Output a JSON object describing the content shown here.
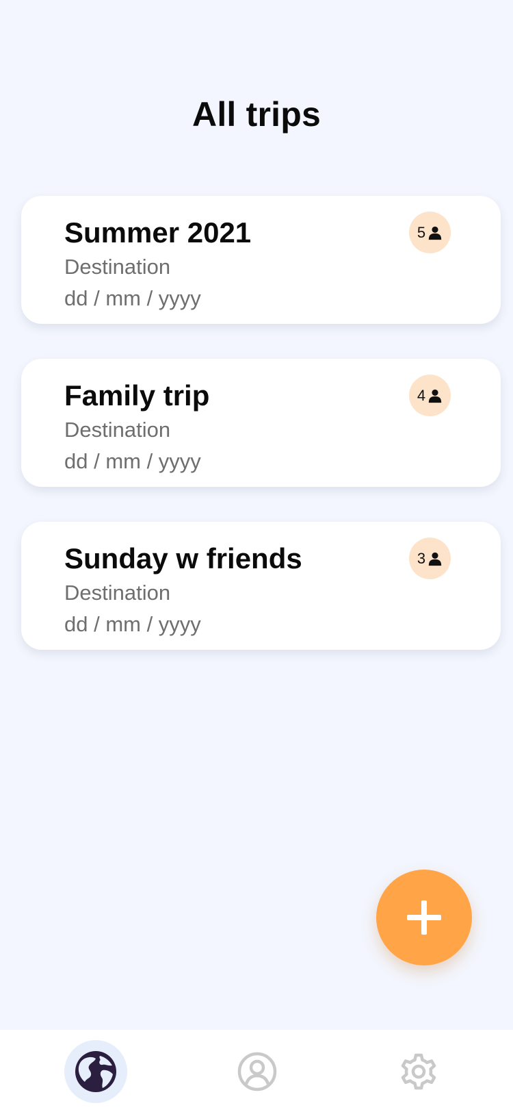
{
  "header": {
    "title": "All trips"
  },
  "trips": [
    {
      "name": "Summer 2021",
      "destination": "Destination",
      "date": "dd / mm / yyyy",
      "members": "5"
    },
    {
      "name": "Family trip",
      "destination": "Destination",
      "date": "dd / mm / yyyy",
      "members": "4"
    },
    {
      "name": "Sunday w friends",
      "destination": "Destination",
      "date": "dd / mm / yyyy",
      "members": "3"
    }
  ],
  "fab": {
    "icon": "plus-icon"
  },
  "nav": {
    "items": [
      {
        "icon": "globe-icon",
        "active": true
      },
      {
        "icon": "user-circle-icon",
        "active": false
      },
      {
        "icon": "gear-icon",
        "active": false
      }
    ]
  },
  "colors": {
    "background": "#f3f6fe",
    "accent": "#ffa447",
    "badge": "#fde3c9",
    "nav_active_bg": "#e6eefb",
    "globe": "#2b1f3f",
    "inactive_icon": "#c9c9c9"
  }
}
